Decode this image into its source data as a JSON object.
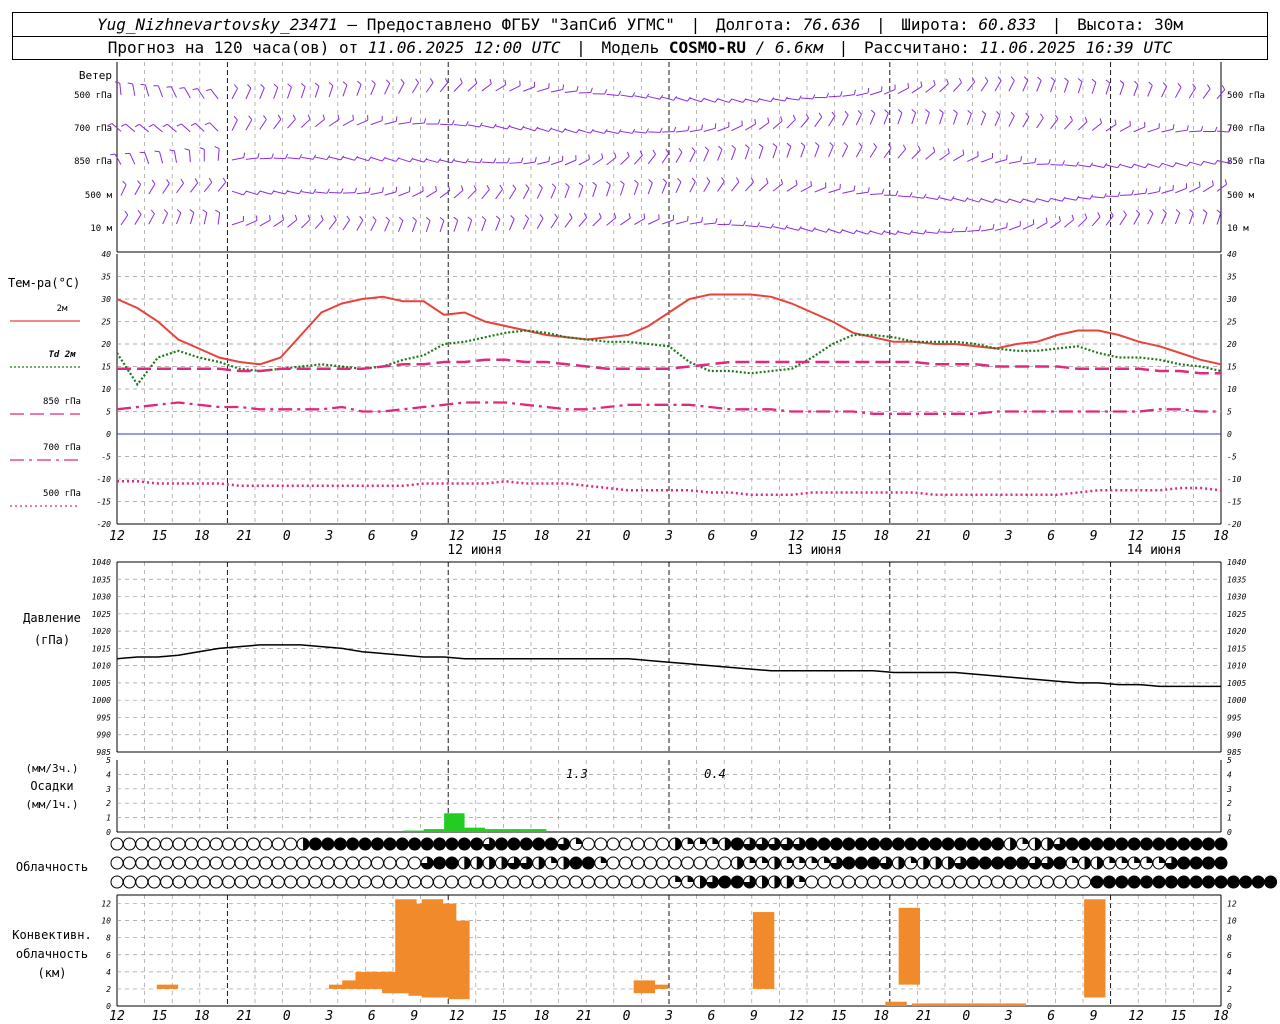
{
  "header": {
    "station": "Yug_Nizhnevartovsky_23471",
    "dash": "–",
    "provider": "Предоставлено ФГБУ \"ЗапСиб УГМС\"",
    "lon_label": "Долгота:",
    "lon_value": "76.636",
    "lat_label": "Широта:",
    "lat_value": "60.833",
    "alt_label": "Высота:",
    "alt_value": "30м",
    "forecast_label": "Прогноз на 120 часа(ов) от",
    "forecast_time": "11.06.2025 12:00 UTC",
    "model_label": "Модель",
    "model_name": "COSMO-RU",
    "model_res": "/ 6.6км",
    "computed_label": "Рассчитано:",
    "computed_time": "11.06.2025 16:39 UTC"
  },
  "panels": {
    "wind": {
      "title": "Ветер",
      "levels": [
        "500 гПа",
        "700 гПа",
        "850 гПа",
        "500 м",
        "10 м"
      ]
    },
    "temperature": {
      "title": "Тем-ра(°С)",
      "legend": [
        {
          "label": "2м",
          "color": "#e8423c",
          "style": "solid"
        },
        {
          "label": "Td 2м",
          "color": "#1a7a1a",
          "style": "dotted"
        },
        {
          "label": "850 гПа",
          "color": "#e0287e",
          "style": "dash"
        },
        {
          "label": "700 гПа",
          "color": "#e0287e",
          "style": "dashdot"
        },
        {
          "label": "500 гПа",
          "color": "#e0287e",
          "style": "dot"
        }
      ]
    },
    "pressure": {
      "title": "Давление",
      "unit": "(гПа)"
    },
    "precip": {
      "unit3": "(мм/3ч.)",
      "title": "Осадки",
      "unit1": "(мм/1ч.)"
    },
    "cloud": {
      "title": "Облачность"
    },
    "convective": {
      "title1": "Конвективн.",
      "title2": "облачность",
      "unit": "(км)"
    }
  },
  "colors": {
    "wind": "#8a2be2",
    "t2m": "#e8423c",
    "td": "#1a7a1a",
    "upper": "#e0287e",
    "zero": "#2b3bd6",
    "pressure": "#000000",
    "precip": "#22cc22",
    "conv": "#f08a2a"
  },
  "chart_data": [
    {
      "type": "line",
      "name": "temperature",
      "x_labels": [
        "12",
        "15",
        "18",
        "21",
        "0",
        "3",
        "6",
        "9",
        "12",
        "15",
        "18",
        "21",
        "0",
        "3",
        "6",
        "9",
        "12",
        "15",
        "18",
        "21",
        "0",
        "3",
        "6",
        "9",
        "12",
        "15",
        "18"
      ],
      "day_labels": [
        {
          "i": 8,
          "text": "12 июня"
        },
        {
          "i": 16,
          "text": "13 июня"
        },
        {
          "i": 24,
          "text": "14 июня"
        }
      ],
      "y_ticks": [
        -20,
        -15,
        -10,
        -5,
        0,
        5,
        10,
        15,
        20,
        25,
        30,
        35,
        40
      ],
      "ylim": [
        -20,
        40
      ],
      "series": [
        {
          "name": "2м",
          "color": "#e8423c",
          "style": "solid",
          "values": [
            30,
            28,
            25,
            21,
            19,
            17,
            16,
            15.5,
            17,
            22,
            27,
            29,
            30,
            30.5,
            29.5,
            29.5,
            26.5,
            27,
            25,
            24,
            23,
            22,
            21.5,
            21,
            21.5,
            22,
            24,
            27,
            30,
            31,
            31,
            31,
            30.5,
            29,
            27,
            25,
            22.5,
            21.5,
            20.5,
            20.5,
            20,
            20,
            19.5,
            19,
            20,
            20.5,
            22,
            23,
            23,
            22,
            20.5,
            19.5,
            18,
            16.5,
            15.5
          ]
        },
        {
          "name": "Td 2м",
          "color": "#1a7a1a",
          "style": "dotted",
          "values": [
            18,
            11,
            17,
            18.5,
            17,
            16,
            14.5,
            14,
            14.5,
            15,
            15.5,
            15,
            14.5,
            15,
            16.5,
            17.5,
            20,
            20.5,
            21.5,
            22.5,
            23,
            22.5,
            21.5,
            21,
            20.5,
            20.5,
            20,
            19.5,
            16,
            14,
            14,
            13.5,
            14,
            14.5,
            17,
            20,
            22,
            22,
            21.5,
            20.5,
            20.5,
            20.5,
            20,
            19,
            18.5,
            18.5,
            19,
            19.5,
            18,
            17,
            17,
            16.5,
            15.5,
            15,
            14
          ]
        },
        {
          "name": "850 гПа",
          "color": "#e0287e",
          "style": "dash",
          "values": [
            14.5,
            14.5,
            14.5,
            14.5,
            14.5,
            14.5,
            14,
            14,
            14.5,
            14.5,
            14.5,
            14.5,
            14.5,
            15,
            15.5,
            15.5,
            16,
            16,
            16.5,
            16.5,
            16,
            16,
            15.5,
            15,
            14.5,
            14.5,
            14.5,
            14.5,
            15,
            15.5,
            16,
            16,
            16,
            16,
            16,
            16,
            16,
            16,
            16,
            16,
            15.5,
            15.5,
            15.5,
            15,
            15,
            15,
            15,
            14.5,
            14.5,
            14.5,
            14.5,
            14,
            14,
            13.5,
            13.5
          ]
        },
        {
          "name": "700 гПа",
          "color": "#e0287e",
          "style": "dashdot",
          "values": [
            5.5,
            6,
            6.5,
            7,
            6.5,
            6,
            6,
            5.5,
            5.5,
            5.5,
            5.5,
            6,
            5,
            5,
            5.5,
            6,
            6.5,
            7,
            7,
            7,
            6.5,
            6,
            5.5,
            5.5,
            6,
            6.5,
            6.5,
            6.5,
            6.5,
            6,
            5.5,
            5.5,
            5.5,
            5,
            5,
            5,
            5,
            4.5,
            4.5,
            4.5,
            4.5,
            4.5,
            4.5,
            5,
            5,
            5,
            5,
            5,
            5,
            5,
            5,
            5.5,
            5.5,
            5,
            5
          ]
        },
        {
          "name": "500 гПа",
          "color": "#e0287e",
          "style": "dot",
          "values": [
            -10.5,
            -10.5,
            -11,
            -11,
            -11,
            -11,
            -11.5,
            -11.5,
            -11.5,
            -11.5,
            -11.5,
            -11.5,
            -11.5,
            -11.5,
            -11.5,
            -11,
            -11,
            -11,
            -11,
            -10.5,
            -11,
            -11,
            -11,
            -11.5,
            -12,
            -12.5,
            -12.5,
            -12.5,
            -12.5,
            -13,
            -13,
            -13.5,
            -13.5,
            -13.5,
            -13,
            -13,
            -13,
            -13,
            -13,
            -13,
            -13.5,
            -13.5,
            -13.5,
            -13.5,
            -13.5,
            -13.5,
            -13.5,
            -13,
            -12.5,
            -12.5,
            -12.5,
            -12.5,
            -12,
            -12,
            -12.5
          ]
        }
      ]
    },
    {
      "type": "line",
      "name": "pressure",
      "y_ticks": [
        985,
        990,
        995,
        1000,
        1005,
        1010,
        1015,
        1020,
        1025,
        1030,
        1035,
        1040
      ],
      "ylim": [
        985,
        1040
      ],
      "values": [
        1012,
        1012.5,
        1012.5,
        1013,
        1014,
        1015,
        1015.5,
        1016,
        1016,
        1016,
        1015.5,
        1015,
        1014,
        1013.5,
        1013,
        1012.5,
        1012.5,
        1012,
        1012,
        1012,
        1012,
        1012,
        1012,
        1012,
        1012,
        1012,
        1011.5,
        1011,
        1010.5,
        1010,
        1009.5,
        1009,
        1008.5,
        1008.5,
        1008.5,
        1008.5,
        1008.5,
        1008.5,
        1008,
        1008,
        1008,
        1008,
        1007.5,
        1007,
        1006.5,
        1006,
        1005.5,
        1005,
        1005,
        1004.5,
        1004.5,
        1004,
        1004,
        1004,
        1004
      ]
    },
    {
      "type": "bar",
      "name": "precipitation",
      "y_ticks": [
        0,
        1,
        2,
        3,
        4,
        5
      ],
      "ylim": [
        0,
        5
      ],
      "labels": [
        {
          "i": 10,
          "text": "1.3"
        },
        {
          "i": 13,
          "text": "0.4"
        }
      ],
      "values": [
        0,
        0,
        0,
        0,
        0,
        0,
        0,
        0,
        0,
        0,
        0,
        0,
        0,
        0,
        0.1,
        0.2,
        1.3,
        0.3,
        0.2,
        0.2,
        0.2,
        0,
        0,
        0,
        0,
        0,
        0,
        0,
        0,
        0,
        0,
        0,
        0,
        0,
        0,
        0,
        0,
        0,
        0,
        0,
        0,
        0,
        0,
        0,
        0,
        0,
        0,
        0,
        0,
        0,
        0,
        0,
        0,
        0,
        0
      ]
    },
    {
      "type": "table",
      "name": "cloudiness",
      "rows": [
        [
          0,
          0,
          0,
          0,
          0,
          0,
          0,
          0,
          0,
          0,
          0,
          0,
          0,
          0,
          0,
          2,
          4,
          4,
          4,
          4,
          4,
          4,
          4,
          4,
          4,
          4,
          4,
          4,
          4,
          4,
          3,
          4,
          4,
          4,
          4,
          4,
          3,
          1,
          0,
          0,
          0,
          0,
          0,
          0,
          0,
          2,
          1,
          1,
          1,
          2,
          4,
          3,
          3,
          3,
          3,
          3,
          4,
          4,
          4,
          4,
          4,
          4,
          4,
          4,
          4,
          4,
          4,
          4,
          4,
          4,
          4,
          4,
          2,
          1,
          2,
          2,
          3,
          4,
          4,
          4,
          4,
          4,
          4,
          4,
          4,
          4,
          4,
          4,
          4,
          4
        ],
        [
          0,
          0,
          0,
          0,
          0,
          0,
          0,
          0,
          0,
          0,
          0,
          0,
          0,
          0,
          0,
          0,
          0,
          0,
          0,
          0,
          0,
          0,
          0,
          0,
          0,
          3,
          4,
          4,
          2,
          2,
          2,
          2,
          3,
          3,
          2,
          1,
          2,
          4,
          4,
          1,
          0,
          0,
          0,
          0,
          0,
          0,
          0,
          0,
          0,
          0,
          2,
          1,
          1,
          2,
          1,
          1,
          1,
          1,
          3,
          4,
          4,
          4,
          3,
          2,
          1,
          2,
          2,
          2,
          3,
          4,
          4,
          4,
          4,
          4,
          3,
          3,
          4,
          1,
          2,
          2,
          1,
          1,
          1,
          1,
          1,
          3,
          4,
          4,
          4,
          4
        ],
        [
          0,
          0,
          0,
          0,
          0,
          0,
          0,
          0,
          0,
          0,
          0,
          0,
          0,
          0,
          0,
          0,
          0,
          0,
          0,
          0,
          0,
          0,
          0,
          0,
          0,
          0,
          0,
          0,
          0,
          0,
          0,
          0,
          0,
          0,
          0,
          0,
          0,
          0,
          0,
          0,
          0,
          0,
          0,
          0,
          0,
          1,
          1,
          2,
          3,
          4,
          4,
          3,
          2,
          2,
          2,
          1,
          0,
          0,
          0,
          0,
          0,
          0,
          0,
          0,
          0,
          0,
          0,
          0,
          0,
          0,
          0,
          0,
          0,
          0,
          0,
          0,
          0,
          0,
          0,
          4,
          4,
          4,
          4,
          4,
          4,
          4,
          4,
          4,
          4,
          4,
          4,
          4,
          4,
          4
        ]
      ]
    },
    {
      "type": "bar",
      "name": "convective_cloud",
      "y_ticks": [
        0,
        2,
        4,
        6,
        8,
        10,
        12
      ],
      "ylim": [
        0,
        13
      ],
      "bars": [
        {
          "i": 3,
          "base": 2,
          "top": 2.5
        },
        {
          "i": 16,
          "base": 2,
          "top": 2.5
        },
        {
          "i": 17,
          "base": 2,
          "top": 3
        },
        {
          "i": 18,
          "base": 2,
          "top": 4
        },
        {
          "i": 19,
          "base": 2,
          "top": 4
        },
        {
          "i": 20,
          "base": 1.5,
          "top": 4
        },
        {
          "i": 21,
          "base": 1.5,
          "top": 12.5
        },
        {
          "i": 22,
          "base": 1.2,
          "top": 12
        },
        {
          "i": 23,
          "base": 1,
          "top": 12.5
        },
        {
          "i": 24,
          "base": 1,
          "top": 12
        },
        {
          "i": 25,
          "base": 0.8,
          "top": 10
        },
        {
          "i": 39,
          "base": 1.5,
          "top": 3
        },
        {
          "i": 40,
          "base": 2,
          "top": 2.5
        },
        {
          "i": 48,
          "base": 2,
          "top": 11
        },
        {
          "i": 58,
          "base": 0,
          "top": 0.5
        },
        {
          "i": 59,
          "base": 2.5,
          "top": 11.5
        },
        {
          "i": 60,
          "base": 0,
          "top": 0.3
        },
        {
          "i": 61,
          "base": 0,
          "top": 0.3
        },
        {
          "i": 62,
          "base": 0,
          "top": 0.3
        },
        {
          "i": 63,
          "base": 0,
          "top": 0.3
        },
        {
          "i": 64,
          "base": 0,
          "top": 0.3
        },
        {
          "i": 65,
          "base": 0,
          "top": 0.3
        },
        {
          "i": 66,
          "base": 0,
          "top": 0.3
        },
        {
          "i": 67,
          "base": 0,
          "top": 0.3
        },
        {
          "i": 73,
          "base": 1,
          "top": 12.5
        }
      ]
    }
  ]
}
